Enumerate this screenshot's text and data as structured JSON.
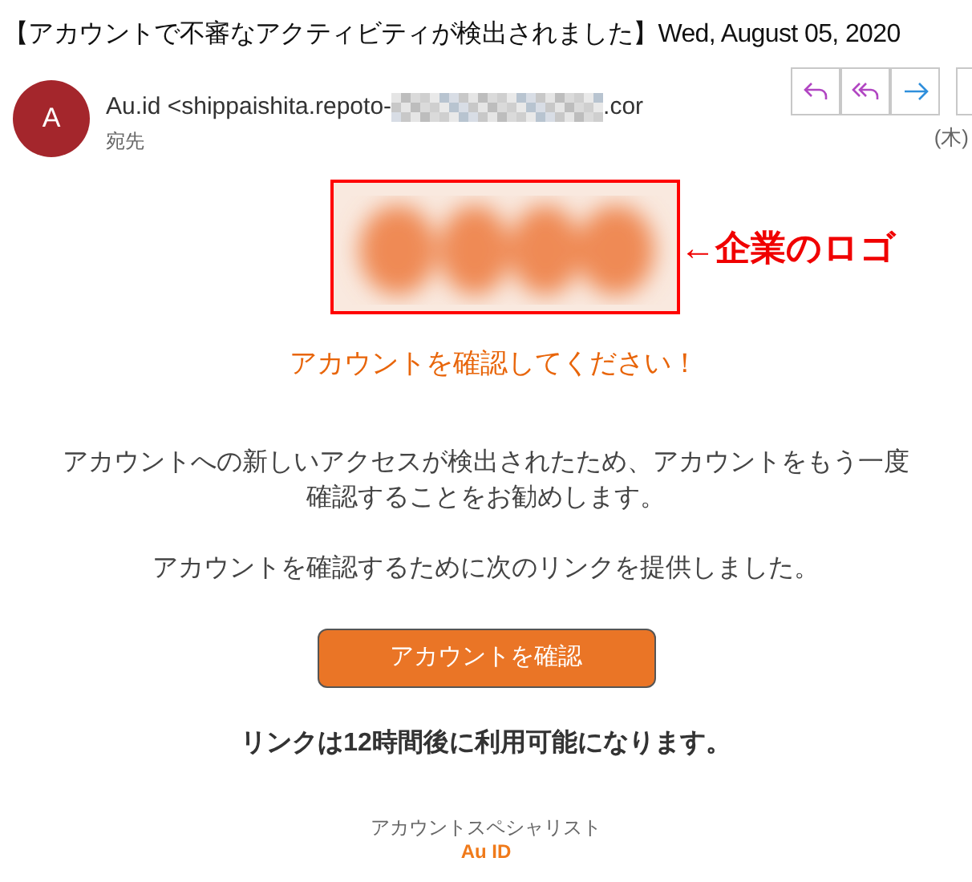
{
  "subject": "【アカウントで不審なアクティビティが検出されました】Wed, August 05, 2020",
  "sender": {
    "avatar": "A",
    "name_start": "Au.id <shippaishita.repoto-",
    "name_end": ".cor",
    "recipient_label": "宛先",
    "date_fragment": "(木)"
  },
  "annotation": {
    "text": "←企業のロゴ"
  },
  "heading": "アカウントを確認してください！",
  "paragraphs": [
    "アカウントへの新しいアクセスが検出されたため、アカウントをもう一度確認することをお勧めします。",
    "アカウントを確認するために次のリンクを提供しました。"
  ],
  "button": "アカウントを確認",
  "notice": "リンクは**12**時間後に利用可能になります。",
  "signature": {
    "role": "アカウントスペシャリスト",
    "company": "Au ID"
  }
}
